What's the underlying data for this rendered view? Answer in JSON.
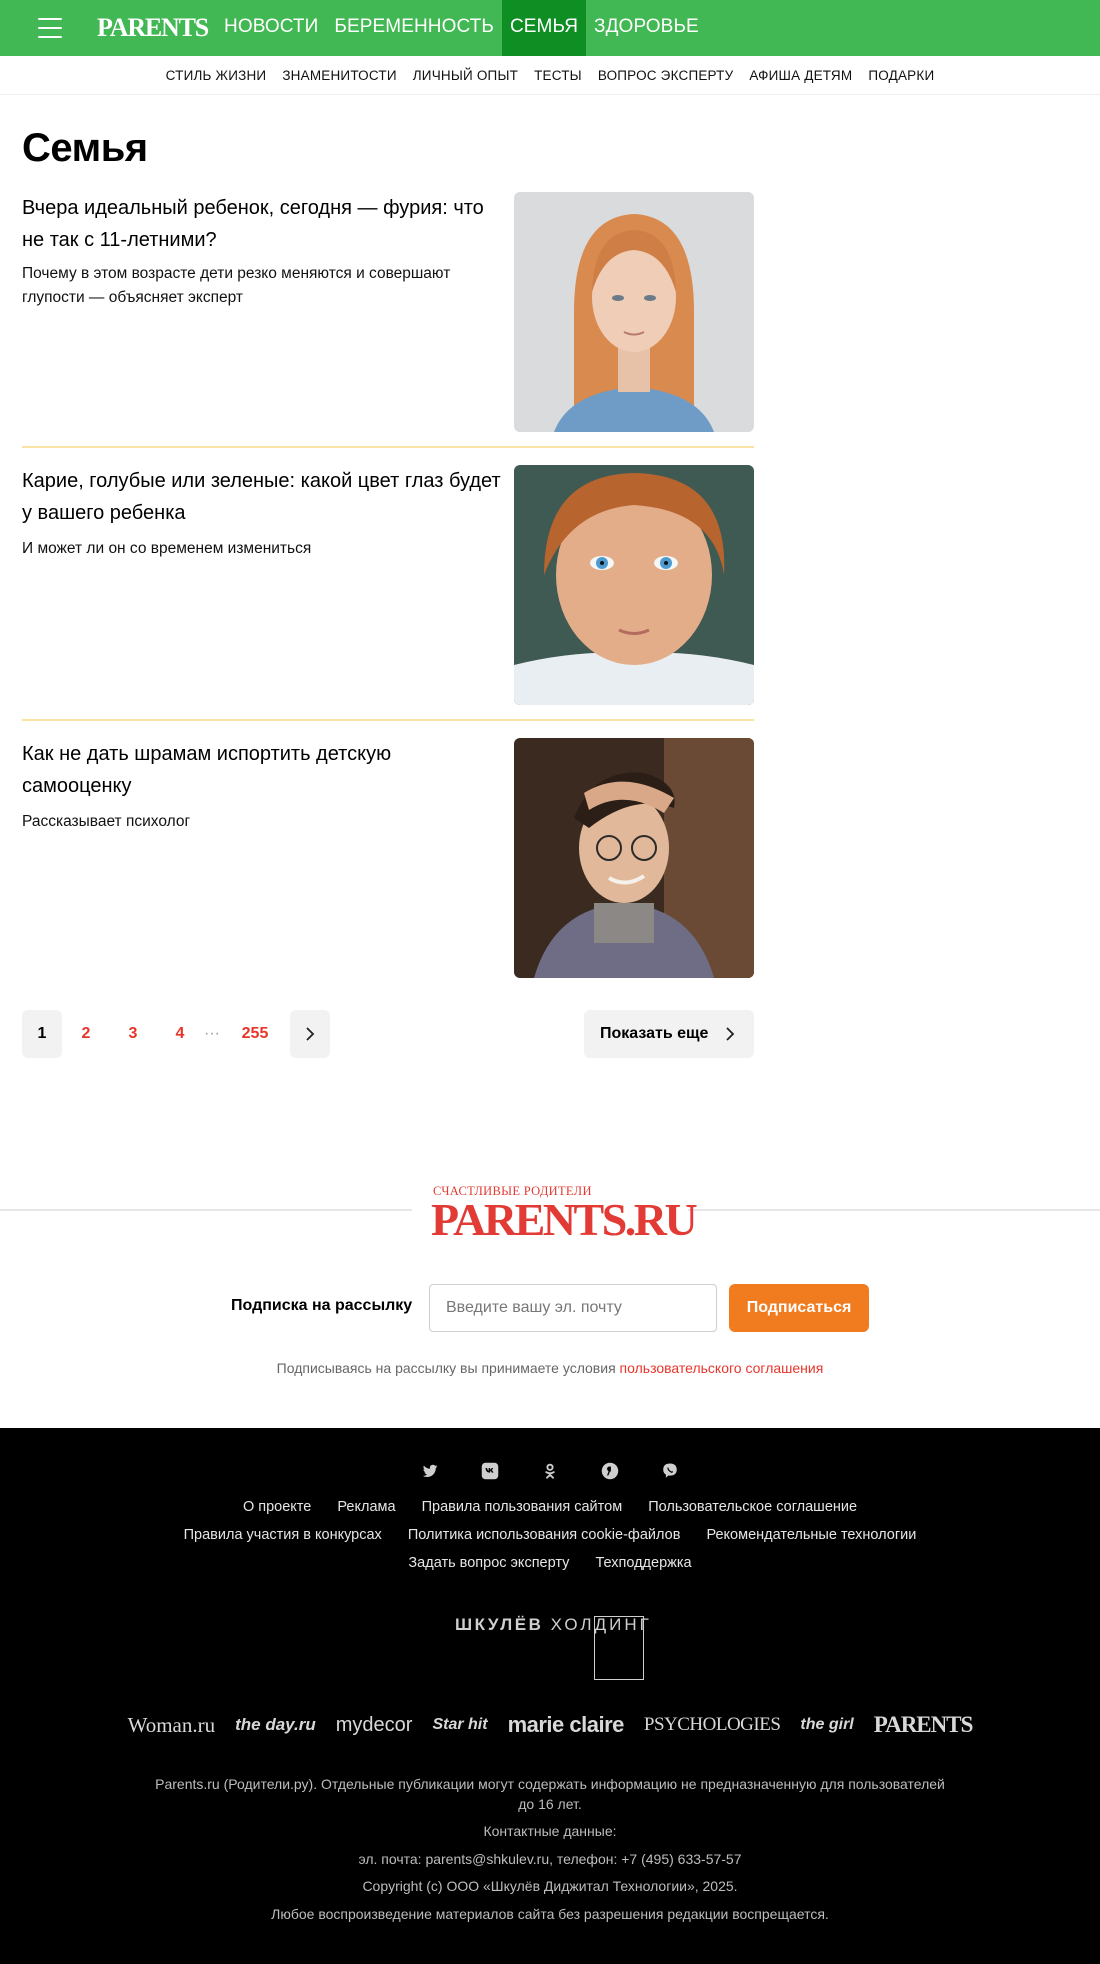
{
  "header": {
    "logo": "PARENTS",
    "nav": [
      {
        "label": "НОВОСТИ",
        "active": false
      },
      {
        "label": "БЕРЕМЕННОСТЬ",
        "active": false
      },
      {
        "label": "СЕМЬЯ",
        "active": true
      },
      {
        "label": "ЗДОРОВЬЕ",
        "active": false
      }
    ],
    "subnav": [
      "СТИЛЬ ЖИЗНИ",
      "ЗНАМЕНИТОСТИ",
      "ЛИЧНЫЙ ОПЫТ",
      "ТЕСТЫ",
      "ВОПРОС ЭКСПЕРТУ",
      "АФИША ДЕТЯМ",
      "ПОДАРКИ"
    ]
  },
  "page": {
    "title": "Семья"
  },
  "articles": [
    {
      "title": "Вчера идеальный ребенок, сегодня — фурия: что не так с 11-летними?",
      "subtitle": "Почему в этом возрасте дети резко меняются и совершают глупости — объясняет эксперт"
    },
    {
      "title": "Карие, голубые или зеленые: какой цвет глаз будет у вашего ребенка",
      "subtitle": "И может ли он со временем измениться"
    },
    {
      "title": "Как не дать шрамам испортить детскую самооценку",
      "subtitle": "Рассказывает психолог"
    }
  ],
  "pagination": {
    "current": "1",
    "pages": [
      "2",
      "3",
      "4"
    ],
    "dots": "···",
    "last": "255",
    "show_more": "Показать еще"
  },
  "footer_brand": {
    "small": "СЧАСТЛИВЫЕ РОДИТЕЛИ",
    "big": "PARENTS.RU"
  },
  "subscribe": {
    "label": "Подписка на рассылку",
    "placeholder": "Введите вашу эл. почту",
    "button": "Подписаться",
    "agree_text": "Подписываясь на рассылку вы принимаете условия ",
    "agree_link": "пользовательского соглашения"
  },
  "footer": {
    "socials": [
      "twitter-icon",
      "vk-icon",
      "odnoklassniki-icon",
      "yandex-icon",
      "viber-icon"
    ],
    "links_row1": [
      "О проекте",
      "Реклама",
      "Правила пользования сайтом",
      "Пользовательское соглашение"
    ],
    "links_row2": [
      "Правила участия в конкурсах",
      "Политика использования cookie-файлов",
      "Рекомендательные технологии"
    ],
    "links_row3": [
      "Задать вопрос эксперту",
      "Техподдержка"
    ],
    "holding_bold": "ШКУЛЁВ",
    "holding_light": "ХОЛДИНГ",
    "brands": [
      "Woman.ru",
      "the day.ru",
      "mydecor",
      "Star hit",
      "marie claire",
      "PSYCHOLOGIES",
      "the girl",
      "PARENTS"
    ],
    "info1": "Parents.ru (Родители.ру). Отдельные публикации могут содержать информацию не предназначенную для пользователей",
    "info1b": "до 16 лет.",
    "info2": "Контактные данные:",
    "info3": "эл. почта: parents@shkulev.ru, телефон: +7 (495) 633-57-57",
    "info4": "Copyright (c) ООО «Шкулёв Диджитал Технологии», 2025.",
    "info5": "Любое воспроизведение материалов сайта без разрешения редакции воспрещается."
  }
}
